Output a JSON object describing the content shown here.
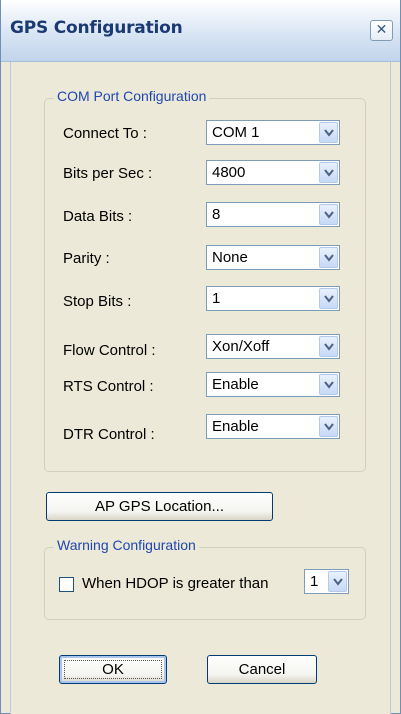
{
  "window": {
    "title": "GPS Configuration",
    "close_glyph": "✕"
  },
  "com_group": {
    "title": "COM Port Configuration",
    "rows": [
      {
        "label": "Connect To :",
        "value": "COM 1"
      },
      {
        "label": "Bits per Sec :",
        "value": "4800"
      },
      {
        "label": "Data Bits :",
        "value": "8"
      },
      {
        "label": "Parity :",
        "value": "None"
      },
      {
        "label": "Stop Bits :",
        "value": "1"
      },
      {
        "label": "Flow Control :",
        "value": "Xon/Xoff"
      },
      {
        "label": "RTS Control :",
        "value": "Enable"
      },
      {
        "label": "DTR Control :",
        "value": "Enable"
      }
    ]
  },
  "ap_gps_button": "AP GPS Location...",
  "warning_group": {
    "title": "Warning Configuration",
    "checkbox_label": "When HDOP is greater than",
    "checkbox_checked": false,
    "hdop_value": "1"
  },
  "buttons": {
    "ok": "OK",
    "cancel": "Cancel"
  },
  "icons": {
    "dropdown": "chevron-down-icon",
    "close": "close-icon"
  },
  "colors": {
    "group_title": "#1f46b2",
    "title_text": "#1b3a73"
  }
}
